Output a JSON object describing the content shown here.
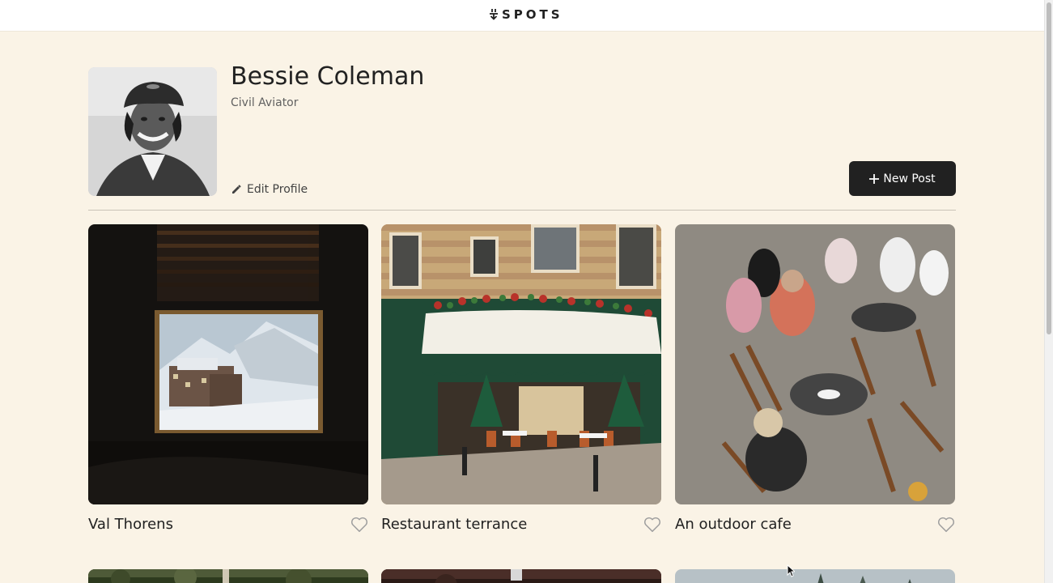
{
  "header": {
    "brand": "SPOTS",
    "brand_icon": "spots-logo-icon"
  },
  "profile": {
    "name": "Bessie Coleman",
    "description": "Civil Aviator",
    "edit_label": "Edit Profile",
    "edit_icon": "pencil-icon"
  },
  "actions": {
    "new_post_label": "New Post",
    "new_post_icon": "plus-icon"
  },
  "cards": [
    {
      "title": "Val Thorens",
      "liked": false
    },
    {
      "title": "Restaurant terrance",
      "liked": false
    },
    {
      "title": "An outdoor cafe",
      "liked": false
    }
  ],
  "colors": {
    "background": "#faf3e6",
    "button": "#212121",
    "text": "#212121",
    "muted": "#616161"
  }
}
